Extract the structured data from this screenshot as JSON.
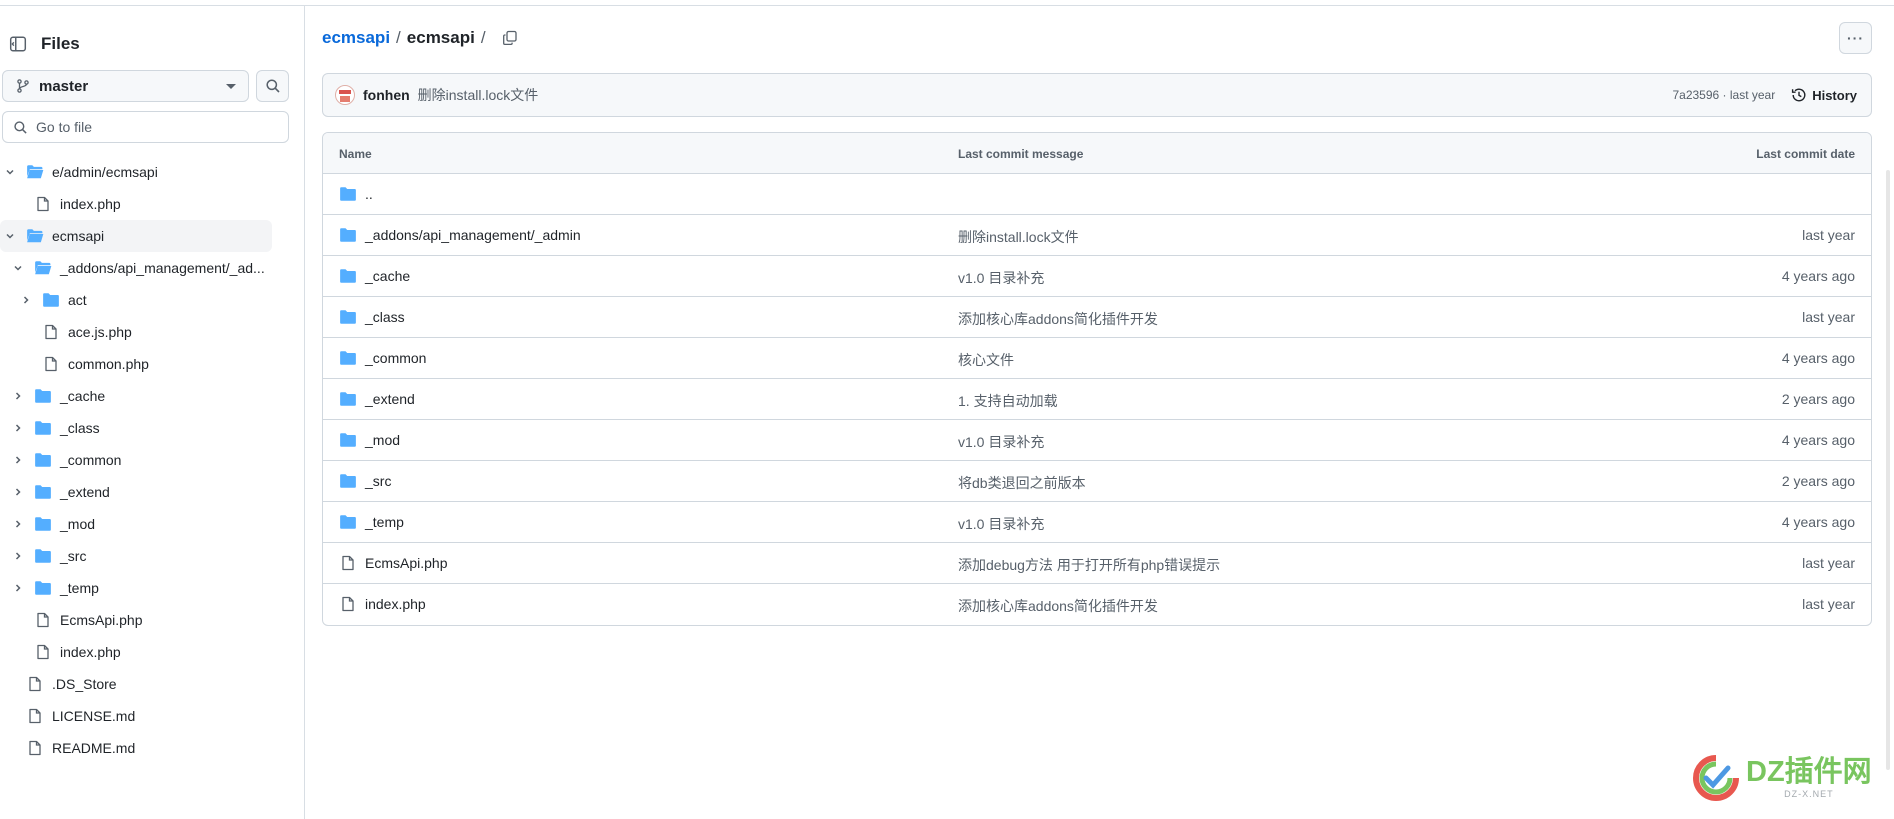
{
  "sidebar": {
    "title": "Files",
    "branch": "master",
    "goto_placeholder": "Go to file",
    "tree": [
      {
        "label": "e/admin/ecmsapi",
        "type": "folder-open",
        "chev": "down",
        "indent": 0
      },
      {
        "label": "index.php",
        "type": "file",
        "chev": "none",
        "indent": 1
      },
      {
        "label": "ecmsapi",
        "type": "folder-open",
        "chev": "down",
        "indent": 0,
        "selected": true
      },
      {
        "label": "_addons/api_management/_ad...",
        "type": "folder-open",
        "chev": "down",
        "indent": 1
      },
      {
        "label": "act",
        "type": "folder",
        "chev": "right",
        "indent": 2
      },
      {
        "label": "ace.js.php",
        "type": "file",
        "chev": "none",
        "indent": 2
      },
      {
        "label": "common.php",
        "type": "file",
        "chev": "none",
        "indent": 2
      },
      {
        "label": "_cache",
        "type": "folder",
        "chev": "right",
        "indent": 1
      },
      {
        "label": "_class",
        "type": "folder",
        "chev": "right",
        "indent": 1
      },
      {
        "label": "_common",
        "type": "folder",
        "chev": "right",
        "indent": 1
      },
      {
        "label": "_extend",
        "type": "folder",
        "chev": "right",
        "indent": 1
      },
      {
        "label": "_mod",
        "type": "folder",
        "chev": "right",
        "indent": 1
      },
      {
        "label": "_src",
        "type": "folder",
        "chev": "right",
        "indent": 1
      },
      {
        "label": "_temp",
        "type": "folder",
        "chev": "right",
        "indent": 1
      },
      {
        "label": "EcmsApi.php",
        "type": "file",
        "chev": "none",
        "indent": 1
      },
      {
        "label": "index.php",
        "type": "file",
        "chev": "none",
        "indent": 1
      },
      {
        "label": ".DS_Store",
        "type": "file",
        "chev": "none",
        "indent": 0
      },
      {
        "label": "LICENSE.md",
        "type": "file",
        "chev": "none",
        "indent": 0
      },
      {
        "label": "README.md",
        "type": "file",
        "chev": "none",
        "indent": 0
      }
    ]
  },
  "breadcrumb": {
    "repo": "ecmsapi",
    "current": "ecmsapi",
    "sep": "/"
  },
  "more_label": "···",
  "commit": {
    "author": "fonhen",
    "message": "删除install.lock文件",
    "sha_time": "7a23596 · last year",
    "history_label": "History"
  },
  "table": {
    "headers": {
      "name": "Name",
      "message": "Last commit message",
      "date": "Last commit date"
    },
    "rows": [
      {
        "name": "..",
        "type": "folder",
        "message": "",
        "date": ""
      },
      {
        "name": "_addons/api_management/_admin",
        "type": "folder",
        "message": "删除install.lock文件",
        "date": "last year"
      },
      {
        "name": "_cache",
        "type": "folder",
        "message": "v1.0 目录补充",
        "date": "4 years ago"
      },
      {
        "name": "_class",
        "type": "folder",
        "message": "添加核心库addons简化插件开发",
        "date": "last year"
      },
      {
        "name": "_common",
        "type": "folder",
        "message": "核心文件",
        "date": "4 years ago"
      },
      {
        "name": "_extend",
        "type": "folder",
        "message": "1. 支持自动加载",
        "date": "2 years ago"
      },
      {
        "name": "_mod",
        "type": "folder",
        "message": "v1.0 目录补充",
        "date": "4 years ago"
      },
      {
        "name": "_src",
        "type": "folder",
        "message": "将db类退回之前版本",
        "date": "2 years ago"
      },
      {
        "name": "_temp",
        "type": "folder",
        "message": "v1.0 目录补充",
        "date": "4 years ago"
      },
      {
        "name": "EcmsApi.php",
        "type": "file",
        "message": "添加debug方法 用于打开所有php错误提示",
        "date": "last year"
      },
      {
        "name": "index.php",
        "type": "file",
        "message": "添加核心库addons简化插件开发",
        "date": "last year"
      }
    ]
  },
  "watermark": {
    "main": "DZ插件网",
    "sub": "DZ-X.NET"
  },
  "colors": {
    "folder": "#54aeff",
    "link": "#0969da",
    "muted": "#57606a",
    "border": "#d0d7de",
    "watermark": "#6bbf4e"
  }
}
